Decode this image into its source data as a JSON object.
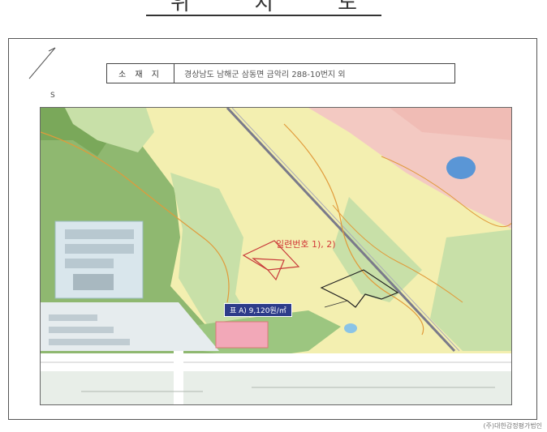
{
  "title": {
    "chars": [
      "위",
      "치",
      "도"
    ]
  },
  "location": {
    "label": "소 재 지",
    "value": "경상남도 남해군 삼동면 금악리 288-10번지 외"
  },
  "scale_mark": "S",
  "map": {
    "parcel_label": "일련번호 1), 2)",
    "price_label": "표 A) 9,120원/㎡"
  },
  "footer": "(주)대한감정평가법인"
}
